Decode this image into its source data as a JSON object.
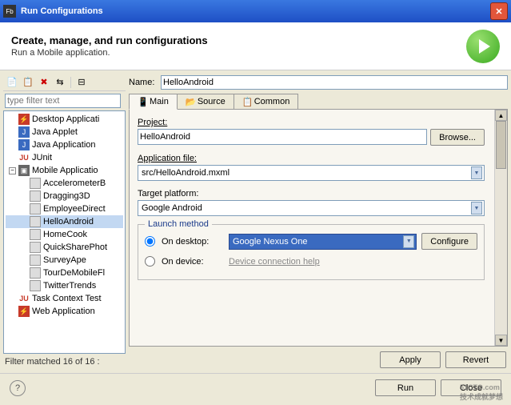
{
  "titlebar": {
    "title": "Run Configurations"
  },
  "header": {
    "title": "Create, manage, and run configurations",
    "subtitle": "Run a Mobile application."
  },
  "filter": {
    "placeholder": "type filter text"
  },
  "tree": {
    "categories": [
      {
        "label": "Desktop Applicati",
        "icon": "red"
      },
      {
        "label": "Java Applet",
        "icon": "blue"
      },
      {
        "label": "Java Application",
        "icon": "blue"
      },
      {
        "label": "JUnit",
        "icon": "ju"
      },
      {
        "label": "Mobile Applicatio",
        "icon": "mob",
        "expanded": true,
        "children": [
          {
            "label": "AccelerometerB"
          },
          {
            "label": "Dragging3D"
          },
          {
            "label": "EmployeeDirect"
          },
          {
            "label": "HelloAndroid",
            "selected": true
          },
          {
            "label": "HomeCook"
          },
          {
            "label": "QuickSharePhot"
          },
          {
            "label": "SurveyApe"
          },
          {
            "label": "TourDeMobileFl"
          },
          {
            "label": "TwitterTrends"
          }
        ]
      },
      {
        "label": "Task Context Test",
        "icon": "ju"
      },
      {
        "label": "Web Application",
        "icon": "red"
      }
    ]
  },
  "filter_status": "Filter matched 16 of 16 :",
  "form": {
    "name_label": "Name:",
    "name_value": "HelloAndroid",
    "tabs": {
      "main": "Main",
      "source": "Source",
      "common": "Common"
    },
    "project_label": "Project:",
    "project_value": "HelloAndroid",
    "browse": "Browse...",
    "appfile_label": "Application file:",
    "appfile_value": "src/HelloAndroid.mxml",
    "platform_label": "Target platform:",
    "platform_value": "Google Android",
    "launch": {
      "legend": "Launch method",
      "desktop": "On desktop:",
      "desktop_value": "Google Nexus One",
      "configure": "Configure",
      "device": "On device:",
      "device_help": "Device connection help"
    }
  },
  "buttons": {
    "apply": "Apply",
    "revert": "Revert",
    "run": "Run",
    "close": "Close"
  },
  "watermark": {
    "brand": "51CTO.com",
    "tag": "技术成就梦想"
  }
}
